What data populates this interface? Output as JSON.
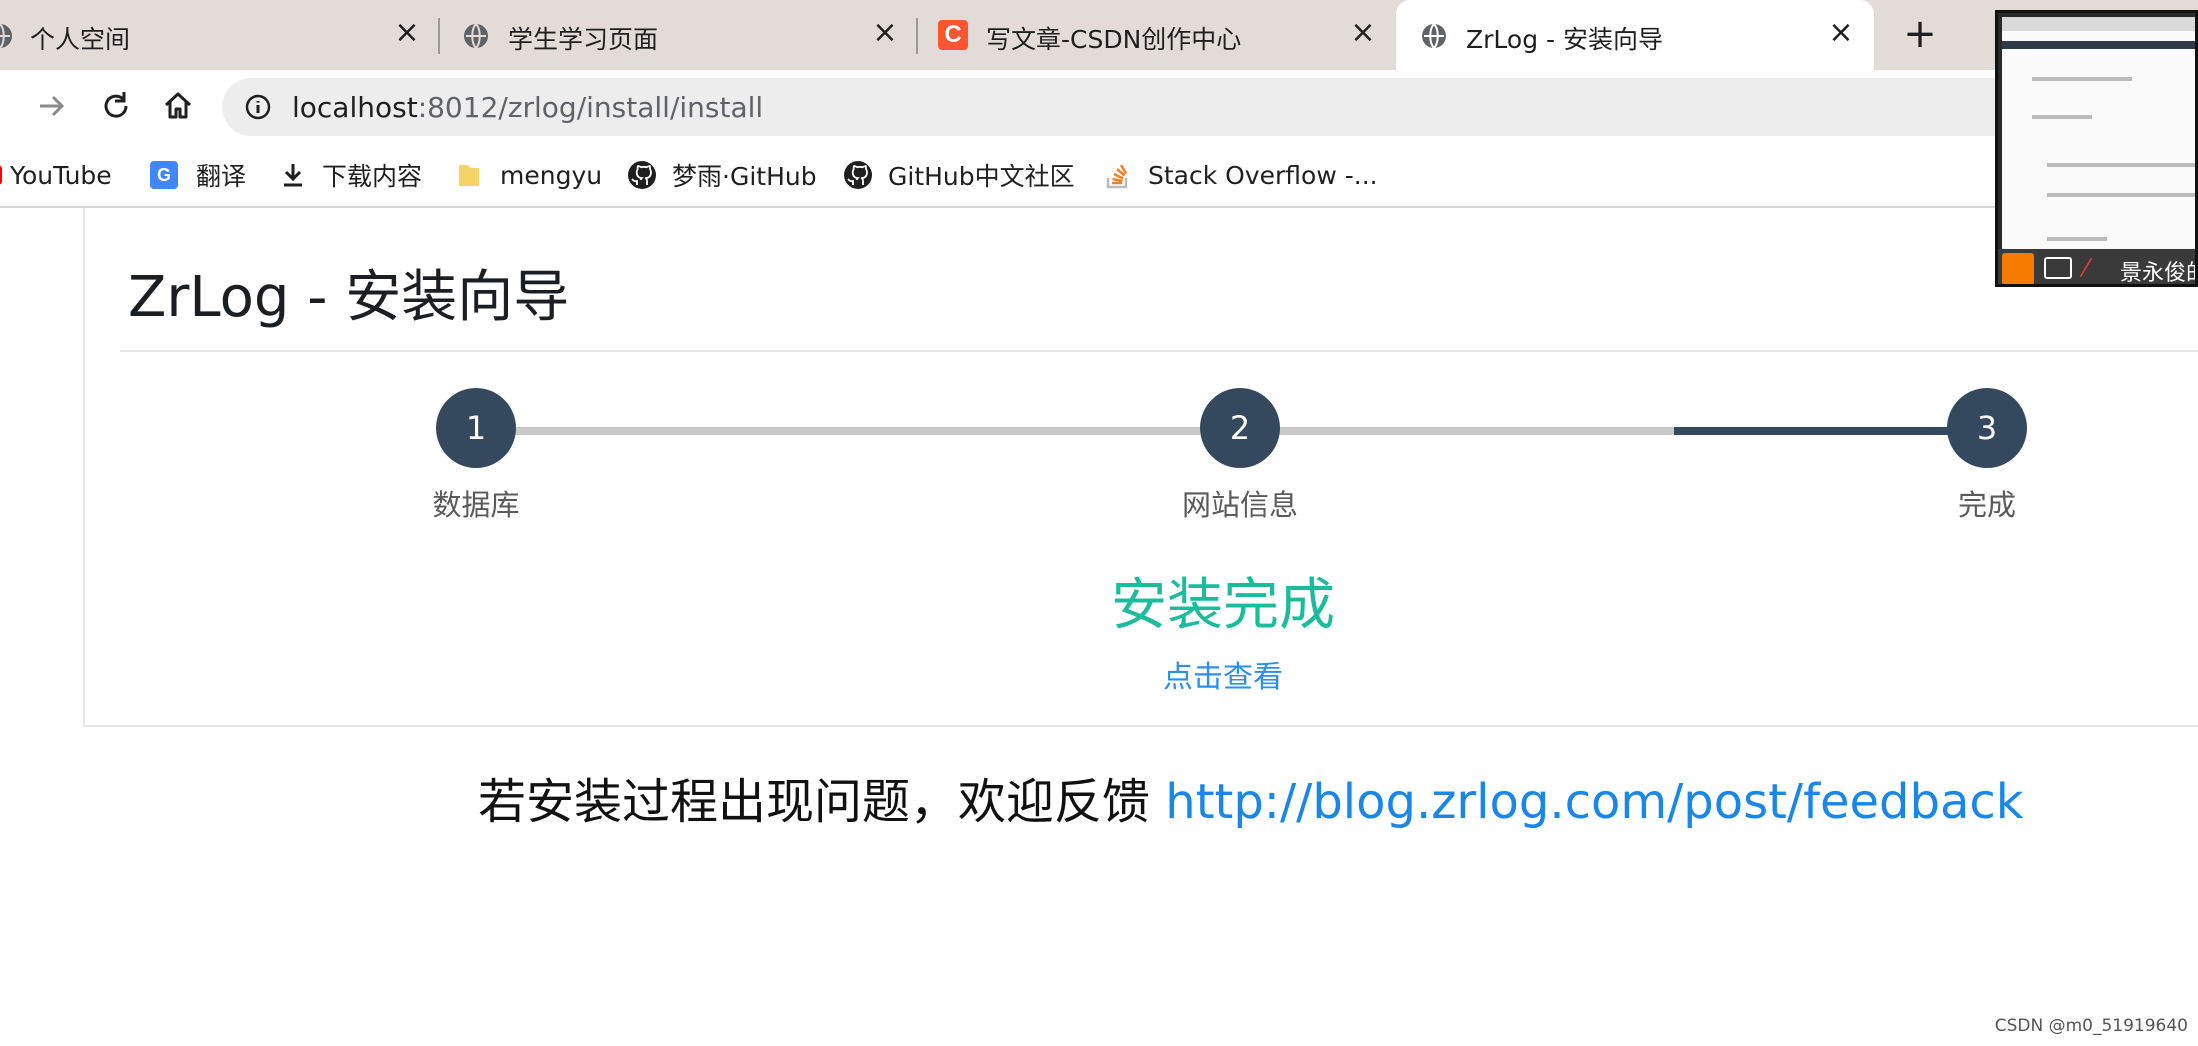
{
  "browser": {
    "tabs": [
      {
        "title": "个人空间",
        "close": "×"
      },
      {
        "title": "学生学习页面",
        "close": "×"
      },
      {
        "title": "写文章-CSDN创作中心",
        "close": "×"
      },
      {
        "title": "ZrLog - 安装向导",
        "close": "×",
        "active": true
      }
    ],
    "new_tab": "+",
    "address": {
      "host": "localhost",
      "path": ":8012/zrlog/install/install"
    },
    "bookmarks": [
      {
        "label": "YouTube"
      },
      {
        "label": "翻译"
      },
      {
        "label": "下载内容"
      },
      {
        "label": "mengyu"
      },
      {
        "label": "梦雨·GitHub"
      },
      {
        "label": "GitHub中文社区"
      },
      {
        "label": "Stack Overflow -..."
      }
    ]
  },
  "page": {
    "title": "ZrLog - 安装向导",
    "steps": [
      {
        "number": "1",
        "label": "数据库"
      },
      {
        "number": "2",
        "label": "网站信息"
      },
      {
        "number": "3",
        "label": "完成"
      }
    ],
    "status": "安装完成",
    "view_link": "点击查看",
    "feedback_text": "若安装过程出现问题，欢迎反馈 ",
    "feedback_link": "http://blog.zrlog.com/post/feedback"
  },
  "overlay": {
    "name": "景永俊的"
  },
  "watermark": "CSDN @m0_51919640",
  "colors": {
    "step": "#34495e",
    "success": "#1abc9c",
    "link": "#1a87e8"
  }
}
